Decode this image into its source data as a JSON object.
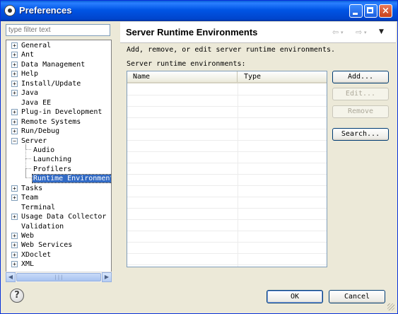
{
  "window": {
    "title": "Preferences",
    "icon": "preferences-gear-icon",
    "controls": {
      "minimize": "minimize-icon",
      "maximize": "maximize-icon",
      "close": "×"
    }
  },
  "sidebar": {
    "filter_placeholder": "type filter text",
    "tree": [
      {
        "label": "General",
        "expander": "+"
      },
      {
        "label": "Ant",
        "expander": "+"
      },
      {
        "label": "Data Management",
        "expander": "+"
      },
      {
        "label": "Help",
        "expander": "+"
      },
      {
        "label": "Install/Update",
        "expander": "+"
      },
      {
        "label": "Java",
        "expander": "+"
      },
      {
        "label": "Java EE",
        "expander": ""
      },
      {
        "label": "Plug-in Development",
        "expander": "+"
      },
      {
        "label": "Remote Systems",
        "expander": "+"
      },
      {
        "label": "Run/Debug",
        "expander": "+"
      },
      {
        "label": "Server",
        "expander": "−"
      },
      {
        "label": "Audio",
        "child": true
      },
      {
        "label": "Launching",
        "child": true
      },
      {
        "label": "Profilers",
        "child": true
      },
      {
        "label": "Runtime Environments",
        "child": true,
        "selected": true
      },
      {
        "label": "Tasks",
        "expander": "+"
      },
      {
        "label": "Team",
        "expander": "+"
      },
      {
        "label": "Terminal",
        "expander": ""
      },
      {
        "label": "Usage Data Collector",
        "expander": "+"
      },
      {
        "label": "Validation",
        "expander": ""
      },
      {
        "label": "Web",
        "expander": "+"
      },
      {
        "label": "Web Services",
        "expander": "+"
      },
      {
        "label": "XDoclet",
        "expander": "+"
      },
      {
        "label": "XML",
        "expander": "+"
      }
    ],
    "scroll_left": "◀",
    "scroll_right": "▶",
    "scroll_thumb": "|||"
  },
  "main": {
    "title": "Server Runtime Environments",
    "nav": {
      "back": "⇦",
      "forward": "⇨",
      "dropdown": "▾",
      "menu": "▼"
    },
    "description": "Add, remove, or edit server runtime environments.",
    "list_label": "Server runtime environments:",
    "table": {
      "columns": [
        "Name",
        "Type"
      ]
    },
    "buttons": {
      "add": "Add...",
      "edit": "Edit...",
      "remove": "Remove",
      "search": "Search..."
    }
  },
  "footer": {
    "help": "?",
    "ok": "OK",
    "cancel": "Cancel"
  }
}
